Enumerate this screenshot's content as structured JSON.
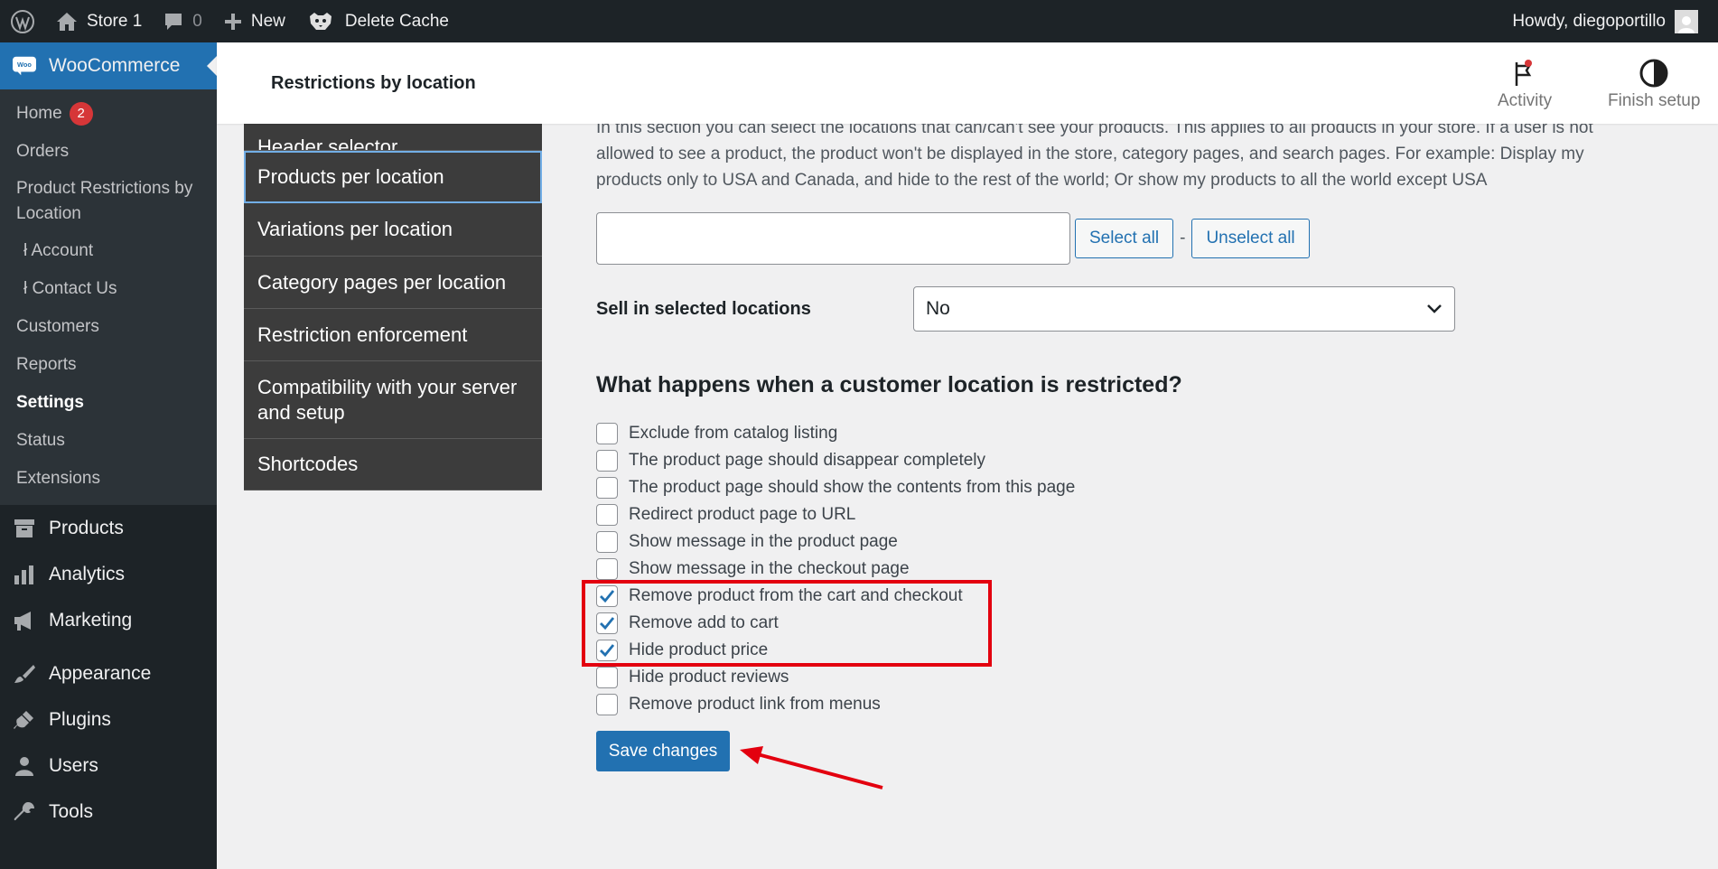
{
  "adminbar": {
    "site_name": "Store 1",
    "comments_count": "0",
    "new_label": "New",
    "delete_cache_label": "Delete Cache",
    "howdy": "Howdy, diegoportillo"
  },
  "sidebar": {
    "woocommerce_label": "WooCommerce",
    "woo_sub": [
      {
        "label": "Home",
        "badge": "2"
      },
      {
        "label": "Orders"
      },
      {
        "label": "Product Restrictions by Location"
      },
      {
        "label": "ł Account"
      },
      {
        "label": "ł Contact Us"
      },
      {
        "label": "Customers"
      },
      {
        "label": "Reports"
      },
      {
        "label": "Settings"
      },
      {
        "label": "Status"
      },
      {
        "label": "Extensions"
      }
    ],
    "products_label": "Products",
    "analytics_label": "Analytics",
    "marketing_label": "Marketing",
    "appearance_label": "Appearance",
    "plugins_label": "Plugins",
    "users_label": "Users",
    "tools_label": "Tools"
  },
  "header": {
    "title": "Restrictions by location",
    "activity_label": "Activity",
    "finish_setup_label": "Finish setup"
  },
  "settings_nav": [
    "Header selector",
    "Products per location",
    "Variations per location",
    "Category pages per location",
    "Restriction enforcement",
    "Compatibility with your server and setup",
    "Shortcodes"
  ],
  "content": {
    "intro": "In this section you can select the locations that can/can't see your products. This applies to all products in your store. If a user is not allowed to see a product, the product won't be displayed in the store, category pages, and search pages. For example: Display my products only to USA and Canada, and hide to the rest of the world; Or show my products to all the world except USA",
    "locations_value": "",
    "select_all": "Select all",
    "dash": "-",
    "unselect_all": "Unselect all",
    "sell_label": "Sell in selected locations",
    "sell_value": "No",
    "section_heading": "What happens when a customer location is restricted?",
    "options": [
      {
        "label": "Exclude from catalog listing",
        "checked": false
      },
      {
        "label": "The product page should disappear completely",
        "checked": false
      },
      {
        "label": "The product page should show the contents from this page",
        "checked": false
      },
      {
        "label": "Redirect product page to URL",
        "checked": false
      },
      {
        "label": "Show message in the product page",
        "checked": false
      },
      {
        "label": "Show message in the checkout page",
        "checked": false
      },
      {
        "label": "Remove product from the cart and checkout",
        "checked": true
      },
      {
        "label": "Remove add to cart",
        "checked": true
      },
      {
        "label": "Hide product price",
        "checked": true
      },
      {
        "label": "Hide product reviews",
        "checked": false
      },
      {
        "label": "Remove product link from menus",
        "checked": false
      }
    ],
    "save_label": "Save changes"
  },
  "colors": {
    "accent": "#2271b1",
    "admin_bg": "#1d2327",
    "annotation": "#e3000f"
  }
}
